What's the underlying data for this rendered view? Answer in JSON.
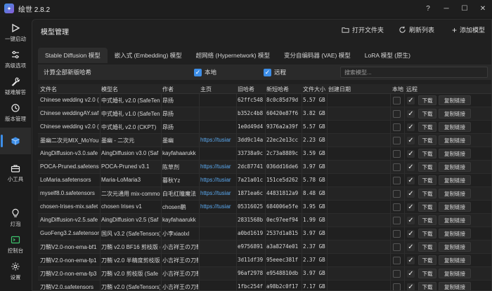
{
  "app": {
    "title": "绘世 2.8.2",
    "logo_icon": "app-logo-icon"
  },
  "window": {
    "help": "?",
    "minimize": "─",
    "maximize": "☐",
    "close": "✕"
  },
  "sidebar": {
    "items": [
      {
        "label": "一键启动",
        "icon": "play-icon"
      },
      {
        "label": "高级选项",
        "icon": "sliders-icon"
      },
      {
        "label": "疑难解答",
        "icon": "wrench-icon"
      },
      {
        "label": "版本管理",
        "icon": "history-icon"
      },
      {
        "label": "",
        "icon": "cube-icon",
        "active": true
      },
      {
        "label": "小工具",
        "icon": "toolbox-icon"
      },
      {
        "label": "灯泡",
        "icon": "lightbulb-icon"
      },
      {
        "label": "控制台",
        "icon": "console-icon"
      },
      {
        "label": "设置",
        "icon": "gear-icon"
      }
    ]
  },
  "header": {
    "title": "模型管理",
    "open_folder": "打开文件夹",
    "refresh": "刷新列表",
    "add_model": "添加模型"
  },
  "tabs": [
    {
      "label": "Stable Diffusion 模型",
      "active": true
    },
    {
      "label": "嵌入式 (Embedding) 模型"
    },
    {
      "label": "超网络 (Hypernetwork) 模型"
    },
    {
      "label": "变分自编码器 (VAE) 模型"
    },
    {
      "label": "LoRA 模型 (原生)"
    }
  ],
  "toolbar": {
    "calc_hash": "计算全部新版哈希",
    "local_label": "本地",
    "local_checked": true,
    "remote_label": "远程",
    "remote_checked": true,
    "search_placeholder": "搜索模型..."
  },
  "table": {
    "headers": {
      "file": "文件名",
      "model": "模型名",
      "author": "作者",
      "home": "主页",
      "old_hash": "旧哈希",
      "new_hash": "新短哈希",
      "size": "文件大小",
      "date": "创建日期",
      "local": "本地",
      "remote": "远程"
    },
    "download_label": "下载",
    "copy_label": "复制链接",
    "rows": [
      {
        "file": "Chinese wedding v2.0 (",
        "model": "中式婚礼 v2.0 (SafeTensors",
        "author": "昂扬",
        "home": "",
        "old_hash": "62ffc548",
        "new_hash": "8c0c85d79d",
        "size": "5.57 GB",
        "date": "",
        "local": false,
        "remote": true
      },
      {
        "file": "Chinese weddingAY.saf",
        "model": "中式婚礼 v1.0 (SafeTens",
        "author": "昂扬",
        "home": "",
        "old_hash": "b352c4b8",
        "new_hash": "60420e87f6",
        "size": "3.82 GB",
        "date": "",
        "local": false,
        "remote": true
      },
      {
        "file": "Chinese wedding v2.0 (",
        "model": "中式婚礼 v2.0 (CKPT)",
        "author": "昂扬",
        "home": "",
        "old_hash": "1e0d49d4",
        "new_hash": "9376a2a39f",
        "size": "5.57 GB",
        "date": "",
        "local": false,
        "remote": true
      },
      {
        "file": "墨幽二次元MIX_MoYou",
        "model": "墨幽 - 二次元",
        "author": "墨幽",
        "home": "https://tusiar",
        "old_hash": "3dd9c14a",
        "new_hash": "22ec2e13cc",
        "size": "2.23 GB",
        "date": "",
        "local": false,
        "remote": true
      },
      {
        "file": "AingDiffusion-v3.0.safe",
        "model": "AingDiffusion v3.0 (Saf",
        "author": "kayfahaarukk",
        "home": "",
        "old_hash": "33738a9c",
        "new_hash": "2c73a8889c",
        "size": "3.59 GB",
        "date": "",
        "local": false,
        "remote": true
      },
      {
        "file": "POCA-Pruned.safetens",
        "model": "POCA-Pruned v3.1",
        "author": "陈草剂",
        "home": "https://tusiar",
        "old_hash": "2dc87741",
        "new_hash": "036dd16de6",
        "size": "3.97 GB",
        "date": "",
        "local": false,
        "remote": true
      },
      {
        "file": "LoMaria.safetensors",
        "model": "Maria-LoMaria3",
        "author": "暮秋Yz",
        "home": "https://tusiar",
        "old_hash": "7a21a01c",
        "new_hash": "151ce5d262",
        "size": "5.78 GB",
        "date": "",
        "local": false,
        "remote": true
      },
      {
        "file": "myself8.0.safetensors",
        "model": "二次元通用 mix-commo",
        "author": "白毛红瞳魔法",
        "home": "https://tusiar",
        "old_hash": "1871ea6c",
        "new_hash": "44831812a9",
        "size": "8.48 GB",
        "date": "",
        "local": false,
        "remote": true
      },
      {
        "file": "chosen-Irises-mix.safet",
        "model": "chosen Irises v1",
        "author": "chosen鹏",
        "home": "https://tusiar",
        "old_hash": "05316025",
        "new_hash": "684006e5fe",
        "size": "3.95 GB",
        "date": "",
        "local": false,
        "remote": true
      },
      {
        "file": "AingDiffusion-v2.5.safe",
        "model": "AingDiffusion v2.5 (Saf",
        "author": "kayfahaarukk",
        "home": "",
        "old_hash": "2831568b",
        "new_hash": "0ec97eef94",
        "size": "1.99 GB",
        "date": "",
        "local": false,
        "remote": true
      },
      {
        "file": "GuoFeng3.2.safetensor",
        "model": "国风 v3.2 (SafeTensors)",
        "author": "小李xiaolxl",
        "home": "",
        "old_hash": "a0bd1619",
        "new_hash": "2537d1a815",
        "size": "3.97 GB",
        "date": "",
        "local": false,
        "remote": true
      },
      {
        "file": "刀鞘V2.0-non-ema-bf1",
        "model": "刀鞘 v2.0 BF16 剪枝版 (",
        "author": "小吉祥王の刀鞘",
        "home": "",
        "old_hash": "e9756891",
        "new_hash": "a3a8274e01",
        "size": "2.37 GB",
        "date": "",
        "local": false,
        "remote": true
      },
      {
        "file": "刀鞘V2.0-non-ema-fp1",
        "model": "刀鞘 v2.0 半精度剪枝版 (",
        "author": "小吉祥王の刀鞘",
        "home": "",
        "old_hash": "3d11df39",
        "new_hash": "95eeec381f",
        "size": "2.37 GB",
        "date": "",
        "local": false,
        "remote": true
      },
      {
        "file": "刀鞘V2.0-non-ema-fp3",
        "model": "刀鞘 v2.0 剪枝版 (Safe",
        "author": "小吉祥王の刀鞘",
        "home": "",
        "old_hash": "96af2978",
        "new_hash": "e9548810db",
        "size": "3.97 GB",
        "date": "",
        "local": false,
        "remote": true
      },
      {
        "file": "刀鞘V2.0.safetensors",
        "model": "刀鞘 v2.0 (SafeTensors)",
        "author": "小吉祥王の刀鞘",
        "home": "",
        "old_hash": "1fbc254f",
        "new_hash": "a98b2c0f17",
        "size": "7.17 GB",
        "date": "",
        "local": false,
        "remote": true
      }
    ]
  }
}
